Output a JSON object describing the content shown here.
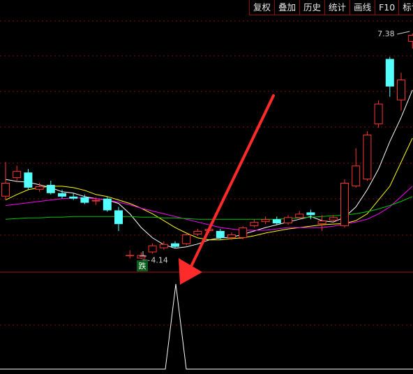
{
  "toolbar": {
    "buttons": [
      {
        "label": "复权"
      },
      {
        "label": "叠加"
      },
      {
        "label": "历史"
      },
      {
        "label": "统计"
      },
      {
        "label": "画线"
      },
      {
        "label": "F10"
      },
      {
        "label": "标记"
      }
    ]
  },
  "chart_data": {
    "type": "candlestick",
    "price_panel": {
      "annotations": {
        "high_label": "7.38",
        "low_label": "4.14",
        "signal_label": "跌"
      },
      "candles": [
        {
          "o": 5.05,
          "c": 5.25,
          "h": 5.55,
          "l": 5.0
        },
        {
          "o": 5.32,
          "c": 5.42,
          "h": 5.5,
          "l": 5.28
        },
        {
          "o": 5.4,
          "c": 5.18,
          "h": 5.45,
          "l": 5.15
        },
        {
          "o": 5.15,
          "c": 5.2,
          "h": 5.25,
          "l": 5.12
        },
        {
          "o": 5.22,
          "c": 5.1,
          "h": 5.28,
          "l": 5.08
        },
        {
          "o": 5.1,
          "c": 5.05,
          "h": 5.15,
          "l": 5.02
        },
        {
          "o": 5.05,
          "c": 5.02,
          "h": 5.1,
          "l": 5.0
        },
        {
          "o": 5.04,
          "c": 4.96,
          "h": 5.08,
          "l": 4.94
        },
        {
          "o": 4.98,
          "c": 5.0,
          "h": 5.04,
          "l": 4.93
        },
        {
          "o": 5.02,
          "c": 4.85,
          "h": 5.05,
          "l": 4.83
        },
        {
          "o": 4.85,
          "c": 4.65,
          "h": 4.9,
          "l": 4.55
        },
        {
          "o": 4.2,
          "c": 4.2,
          "h": 4.27,
          "l": 4.15
        },
        {
          "o": 4.15,
          "c": 4.2,
          "h": 4.24,
          "l": 4.14
        },
        {
          "o": 4.24,
          "c": 4.34,
          "h": 4.37,
          "l": 4.22
        },
        {
          "o": 4.3,
          "c": 4.36,
          "h": 4.4,
          "l": 4.28
        },
        {
          "o": 4.37,
          "c": 4.32,
          "h": 4.4,
          "l": 4.3
        },
        {
          "o": 4.36,
          "c": 4.5,
          "h": 4.52,
          "l": 4.34
        },
        {
          "o": 4.5,
          "c": 4.55,
          "h": 4.58,
          "l": 4.48
        },
        {
          "o": 4.55,
          "c": 4.58,
          "h": 4.6,
          "l": 4.52
        },
        {
          "o": 4.55,
          "c": 4.45,
          "h": 4.58,
          "l": 4.42
        },
        {
          "o": 4.45,
          "c": 4.5,
          "h": 4.53,
          "l": 4.42
        },
        {
          "o": 4.45,
          "c": 4.6,
          "h": 4.62,
          "l": 4.43
        },
        {
          "o": 4.62,
          "c": 4.68,
          "h": 4.72,
          "l": 4.6
        },
        {
          "o": 4.68,
          "c": 4.72,
          "h": 4.76,
          "l": 4.65
        },
        {
          "o": 4.72,
          "c": 4.66,
          "h": 4.76,
          "l": 4.64
        },
        {
          "o": 4.66,
          "c": 4.75,
          "h": 4.78,
          "l": 4.64
        },
        {
          "o": 4.74,
          "c": 4.8,
          "h": 4.84,
          "l": 4.72
        },
        {
          "o": 4.82,
          "c": 4.78,
          "h": 4.86,
          "l": 4.72
        },
        {
          "o": 4.65,
          "c": 4.7,
          "h": 4.78,
          "l": 4.55
        },
        {
          "o": 4.7,
          "c": 4.75,
          "h": 4.78,
          "l": 4.68
        },
        {
          "o": 4.62,
          "c": 5.25,
          "h": 5.3,
          "l": 4.6
        },
        {
          "o": 5.2,
          "c": 5.5,
          "h": 5.75,
          "l": 5.18
        },
        {
          "o": 5.3,
          "c": 5.95,
          "h": 6.0,
          "l": 5.28
        },
        {
          "o": 6.1,
          "c": 6.4,
          "h": 6.45,
          "l": 6.05
        },
        {
          "o": 7.05,
          "c": 6.65,
          "h": 7.08,
          "l": 6.5
        },
        {
          "o": 6.45,
          "c": 6.75,
          "h": 6.85,
          "l": 6.3
        },
        {
          "o": 7.3,
          "c": 7.4,
          "h": 7.42,
          "l": 7.2
        }
      ],
      "moving_averages": [
        {
          "color": "#ffffff",
          "values": [
            5.3,
            5.27,
            5.26,
            5.22,
            5.18,
            5.12,
            5.1,
            5.05,
            5.02,
            5.0,
            4.95,
            4.8,
            4.6,
            4.45,
            4.35,
            4.3,
            4.32,
            4.36,
            4.42,
            4.45,
            4.46,
            4.5,
            4.55,
            4.6,
            4.64,
            4.68,
            4.72,
            4.76,
            4.7,
            4.68,
            4.75,
            4.9,
            5.15,
            5.45,
            5.85,
            6.2,
            6.6
          ]
        },
        {
          "color": "#ffff00",
          "values": [
            5.0,
            5.08,
            5.15,
            5.18,
            5.2,
            5.2,
            5.18,
            5.14,
            5.08,
            5.05,
            5.0,
            4.95,
            4.88,
            4.8,
            4.7,
            4.6,
            4.52,
            4.45,
            4.42,
            4.42,
            4.44,
            4.45,
            4.48,
            4.52,
            4.55,
            4.58,
            4.6,
            4.62,
            4.64,
            4.65,
            4.66,
            4.7,
            4.8,
            5.0,
            5.2,
            5.55,
            5.9
          ]
        },
        {
          "color": "#ff00ff",
          "values": [
            4.92,
            4.94,
            4.96,
            4.98,
            5.0,
            5.02,
            5.03,
            5.03,
            5.02,
            5.0,
            4.97,
            4.93,
            4.88,
            4.84,
            4.8,
            4.76,
            4.72,
            4.68,
            4.64,
            4.6,
            4.58,
            4.56,
            4.56,
            4.56,
            4.58,
            4.6,
            4.6,
            4.6,
            4.6,
            4.62,
            4.65,
            4.68,
            4.72,
            4.8,
            4.9,
            5.05,
            5.2
          ]
        },
        {
          "color": "#00c800",
          "values": [
            4.72,
            4.73,
            4.74,
            4.74,
            4.75,
            4.75,
            4.76,
            4.76,
            4.76,
            4.76,
            4.76,
            4.76,
            4.75,
            4.75,
            4.74,
            4.74,
            4.73,
            4.72,
            4.72,
            4.72,
            4.72,
            4.72,
            4.72,
            4.72,
            4.72,
            4.73,
            4.74,
            4.75,
            4.76,
            4.77,
            4.78,
            4.8,
            4.83,
            4.87,
            4.92,
            4.98,
            5.05
          ]
        }
      ]
    },
    "indicator_panel": {
      "type": "line",
      "values": [
        0,
        0,
        0,
        0,
        0,
        0,
        0,
        0,
        0,
        0,
        0,
        0,
        0,
        0,
        0,
        0,
        0,
        0,
        0,
        0,
        0,
        0,
        0,
        0,
        0,
        0,
        0,
        0,
        0,
        0,
        0,
        0,
        0,
        0,
        0,
        0,
        0
      ],
      "spike": {
        "values": [
          0,
          1,
          0
        ]
      }
    }
  }
}
